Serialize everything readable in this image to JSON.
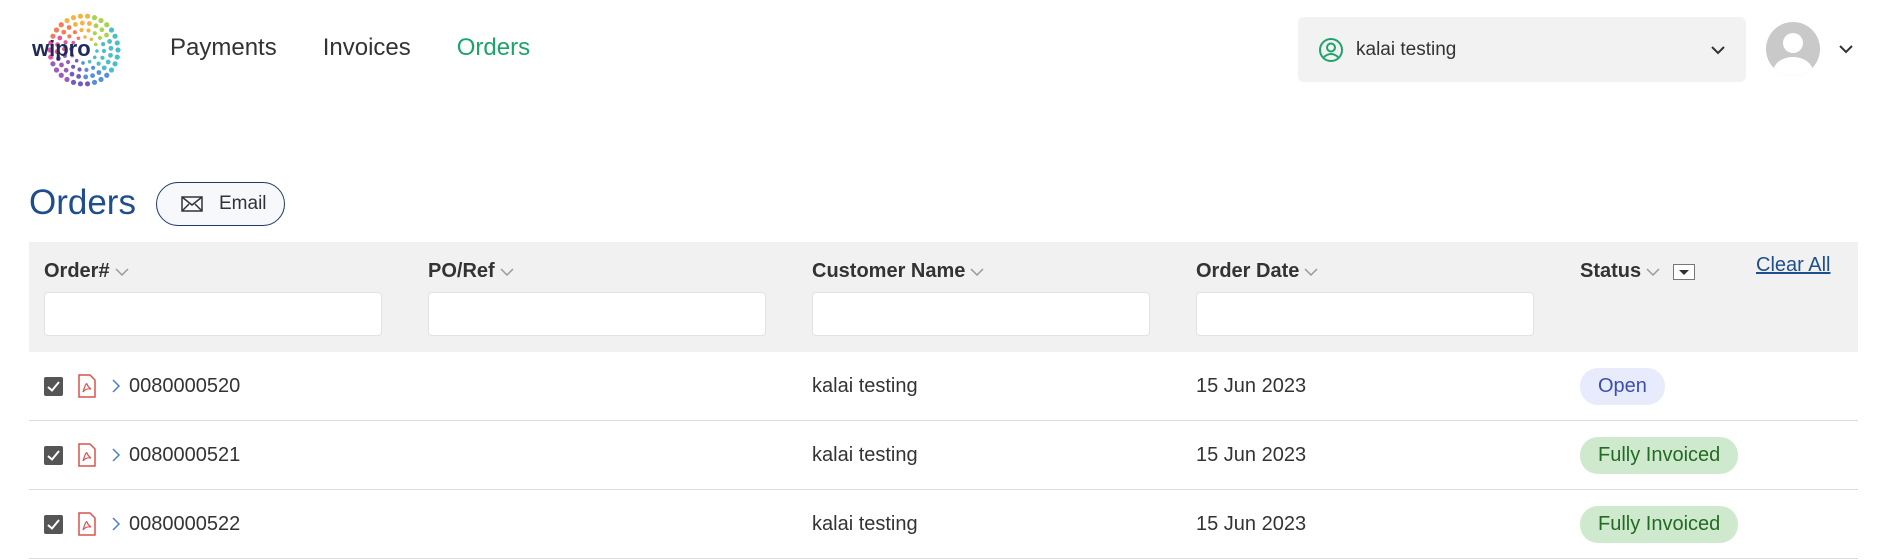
{
  "header": {
    "logo_text": "wipro",
    "nav": [
      {
        "label": "Payments",
        "active": false
      },
      {
        "label": "Invoices",
        "active": false
      },
      {
        "label": "Orders",
        "active": true
      }
    ],
    "account": {
      "label": "kalai testing",
      "icon": "user-circle-icon"
    },
    "profile": {
      "icon": "avatar-icon"
    }
  },
  "page": {
    "title": "Orders",
    "email_button": "Email"
  },
  "table": {
    "columns": [
      {
        "label": "Order#",
        "filter_value": ""
      },
      {
        "label": "PO/Ref",
        "filter_value": ""
      },
      {
        "label": "Customer Name",
        "filter_value": ""
      },
      {
        "label": "Order Date",
        "filter_value": ""
      },
      {
        "label": "Status"
      }
    ],
    "clear_all": "Clear All",
    "rows": [
      {
        "checked": true,
        "order_no": "0080000520",
        "po_ref": "",
        "customer": "kalai testing",
        "date": "15 Jun 2023",
        "status": "Open"
      },
      {
        "checked": true,
        "order_no": "0080000521",
        "po_ref": "",
        "customer": "kalai testing",
        "date": "15 Jun 2023",
        "status": "Fully Invoiced"
      },
      {
        "checked": true,
        "order_no": "0080000522",
        "po_ref": "",
        "customer": "kalai testing",
        "date": "15 Jun 2023",
        "status": "Fully Invoiced"
      }
    ]
  },
  "colors": {
    "accent_green": "#1ea36a",
    "title_blue": "#1f4e8c",
    "open_badge": "#e7ebfb",
    "invoiced_badge": "#cfe9cf",
    "pdf_red": "#d9534f"
  }
}
